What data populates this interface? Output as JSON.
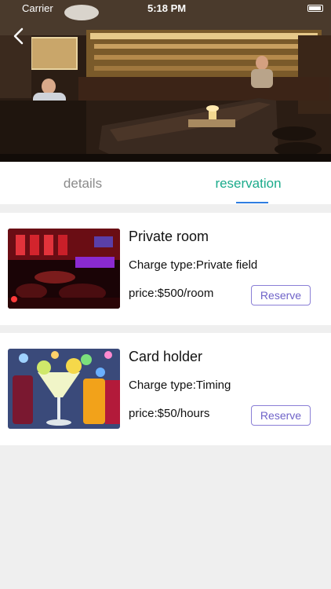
{
  "status_bar": {
    "carrier": "Carrier",
    "time": "5:18 PM"
  },
  "header": {
    "back_icon": "chevron-left-icon"
  },
  "tabs": [
    {
      "label": "details",
      "active": false
    },
    {
      "label": "reservation",
      "active": true
    }
  ],
  "colors": {
    "active_tab": "#1bab8b",
    "underline": "#2f7de1",
    "button_border": "#8a7fd6",
    "button_text": "#6f63c9"
  },
  "items": [
    {
      "title": "Private room",
      "charge": "Charge type:Private field",
      "price": "price:$500/room",
      "button": "Reserve",
      "image": "club-room-photo"
    },
    {
      "title": "Card holder",
      "charge": "Charge type:Timing",
      "price": "price:$50/hours",
      "button": "Reserve",
      "image": "cocktails-photo"
    }
  ]
}
